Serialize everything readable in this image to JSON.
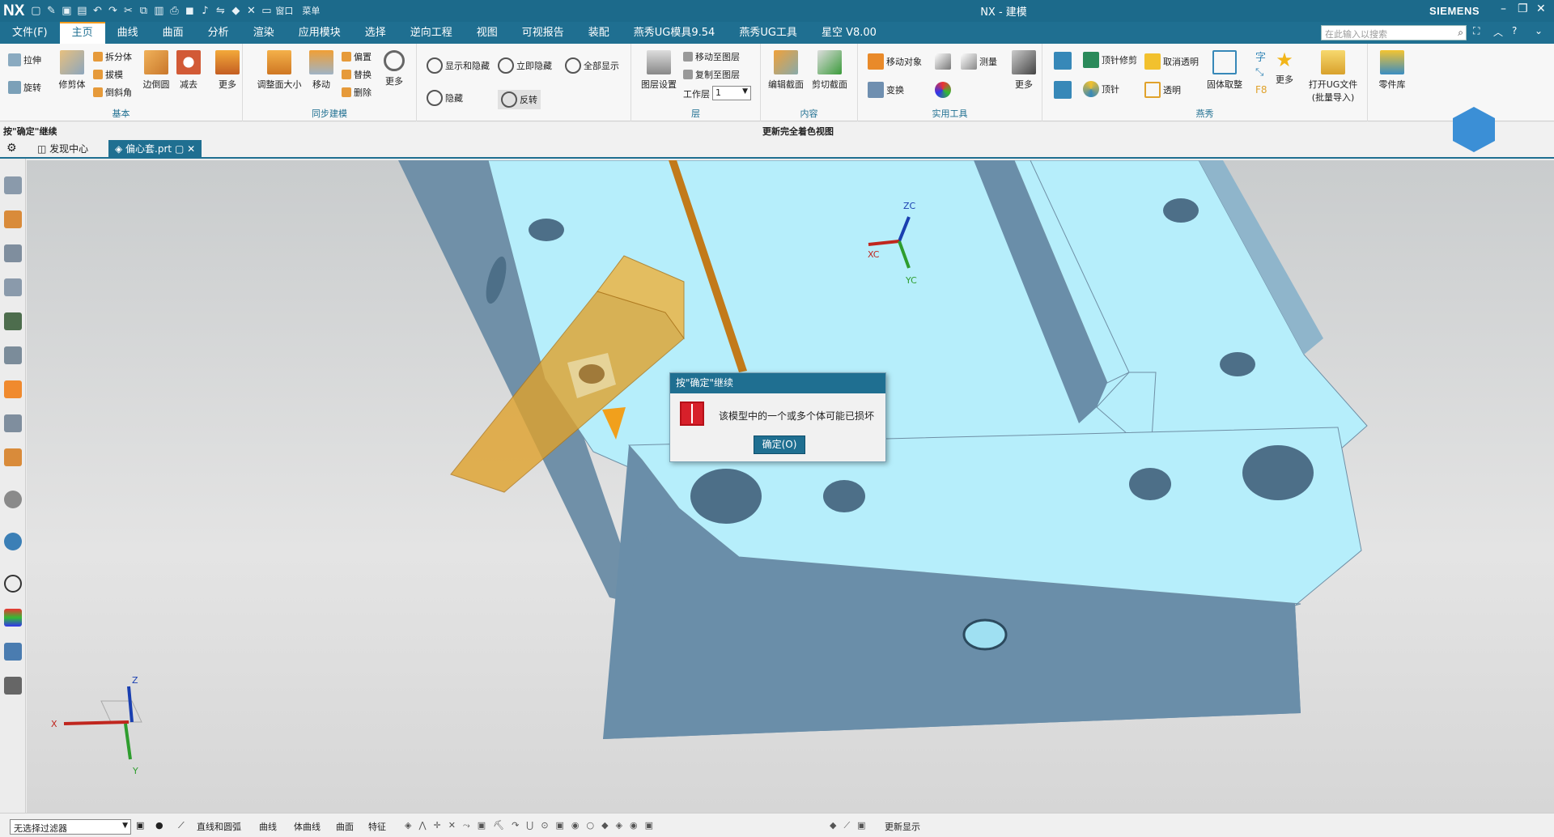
{
  "window": {
    "logo": "NX",
    "title": "NX - 建模",
    "brand": "SIEMENS",
    "minimize_icon": "–",
    "restore_icon": "❐",
    "close_icon": "✕"
  },
  "menubar": {
    "tabs": [
      "文件(F)",
      "主页",
      "曲线",
      "曲面",
      "分析",
      "渲染",
      "应用模块",
      "选择",
      "逆向工程",
      "视图",
      "可视报告",
      "装配",
      "燕秀UG模具9.54",
      "燕秀UG工具",
      "星空 V8.00"
    ],
    "active": 1,
    "search_placeholder": "在此输入以搜索",
    "qat_menu": "菜单",
    "qat_window": "窗口"
  },
  "ribbon": {
    "basic": {
      "label": "基本",
      "extrude": "拉伸",
      "revolve": "旋转",
      "trim_body": "修剪体",
      "split_body": "拆分体",
      "draft": "拔模",
      "chamfer": "倒斜角",
      "edge_blend": "边倒圆",
      "subtract": "减去",
      "more": "更多"
    },
    "sync": {
      "label": "同步建模",
      "resize_face": "调整面大小",
      "move": "移动",
      "offset": "偏置",
      "replace": "替换",
      "delete": "删除",
      "more": "更多"
    },
    "show": {
      "show_hide": "显示和隐藏",
      "instant_hide": "立即隐藏",
      "show_all": "全部显示",
      "hide": "隐藏",
      "invert": "反转"
    },
    "layer": {
      "label": "层",
      "layer_settings": "图层设置",
      "move_to_layer": "移动至图层",
      "copy_to_layer": "复制至图层",
      "work_layer": "工作层",
      "work_layer_value": "1"
    },
    "view": {
      "label": "更新完全着色视图"
    },
    "content": {
      "label": "内容",
      "edit_section": "编辑截面",
      "clip_section": "剪切截面"
    },
    "utility": {
      "label": "实用工具",
      "move_object": "移动对象",
      "measure": "测量",
      "transform": "变换",
      "more": "更多"
    },
    "yanxiu": {
      "label": "燕秀",
      "ejector_trim": "顶针修剪",
      "cancel_transparent": "取消透明",
      "ejector": "顶针",
      "transparent": "透明",
      "body_extract": "固体取整",
      "char": "字",
      "f8": "F8",
      "more": "更多",
      "open_ug": "打开UG文件",
      "open_ug2": "(批量导入)",
      "part_lib": "零件库"
    }
  },
  "cuebar": {
    "left": "按\"确定\"继续",
    "center": "更新完全着色视图"
  },
  "doctabs": {
    "discover": "发现中心",
    "part": "偏心套.prt"
  },
  "viewport": {
    "wcs": {
      "zc": "ZC",
      "xc": "XC",
      "yc": "YC"
    },
    "triad": {
      "z": "Z",
      "x": "X",
      "y": "Y"
    }
  },
  "dialog": {
    "title": "按\"确定\"继续",
    "message": "该模型中的一个或多个体可能已损坏",
    "ok": "确定(O)"
  },
  "bottombar": {
    "filter": "无选择过滤器",
    "curve_arc": "直线和圆弧",
    "curve": "曲线",
    "body_curve": "体曲线",
    "surface": "曲面",
    "feature": "特征",
    "update": "更新显示"
  },
  "colors": {
    "accent": "#1f6f91",
    "model_top": "#b6eefb",
    "model_side": "#6a8ea9",
    "highlight": "#e0a22c",
    "error": "#d7202a"
  }
}
